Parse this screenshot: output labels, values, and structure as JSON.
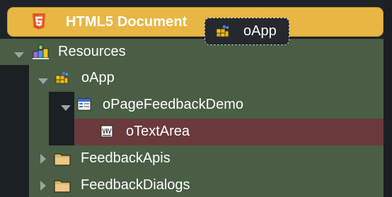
{
  "document": {
    "title": "HTML5 Document",
    "icon": "html5-icon"
  },
  "drag_tag": {
    "label": "oApp",
    "icon": "app-icon"
  },
  "tree": {
    "resources": {
      "label": "Resources",
      "icon": "resources-icon",
      "expanded": true
    },
    "oapp": {
      "label": "oApp",
      "icon": "app-icon",
      "expanded": true
    },
    "page": {
      "label": "oPageFeedbackDemo",
      "icon": "page-icon",
      "expanded": true
    },
    "textarea": {
      "label": "oTextArea",
      "icon": "textarea-icon",
      "selected": true
    },
    "feedback_apis": {
      "label": "FeedbackApis",
      "icon": "folder-icon",
      "expanded": false
    },
    "feedback_dialogs": {
      "label": "FeedbackDialogs",
      "icon": "folder-icon",
      "expanded": false
    }
  },
  "colors": {
    "header": "#e8b642",
    "tree_bg": "#495e45",
    "selected": "#6a3a3c",
    "sidebar": "#1d2327"
  }
}
